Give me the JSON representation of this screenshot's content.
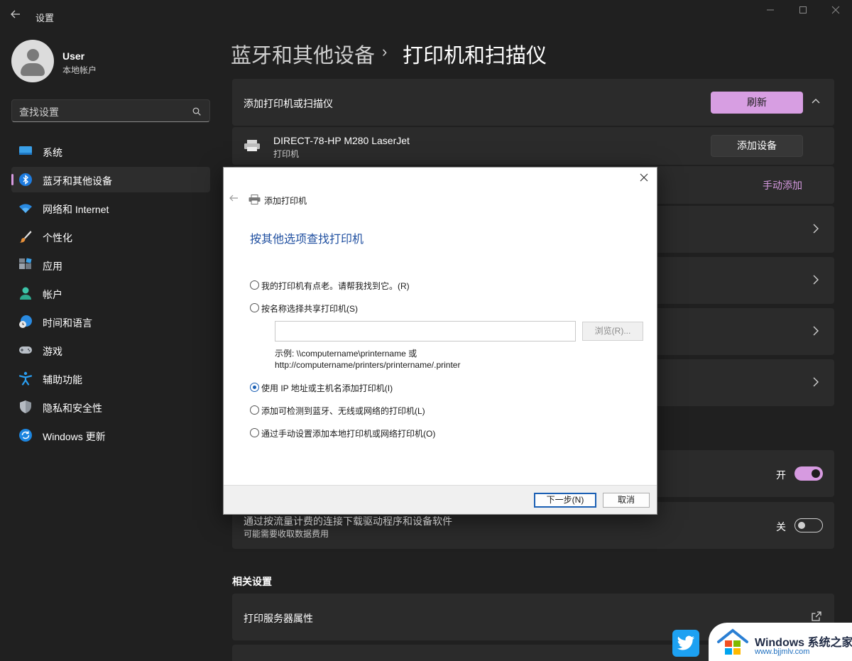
{
  "titlebar": {
    "app_title": "设置",
    "back_icon": "arrow-left-icon",
    "minimize_icon": "minimize-icon",
    "maximize_icon": "maximize-icon",
    "close_icon": "close-icon"
  },
  "profile": {
    "name": "User",
    "account_type": "本地帐户"
  },
  "search": {
    "placeholder": "查找设置"
  },
  "sidebar": {
    "accent_color": "#d69ae0",
    "items": [
      {
        "label": "系统",
        "icon": "monitor-icon"
      },
      {
        "label": "蓝牙和其他设备",
        "icon": "bluetooth-icon",
        "selected": true
      },
      {
        "label": "网络和 Internet",
        "icon": "wifi-icon"
      },
      {
        "label": "个性化",
        "icon": "brush-icon"
      },
      {
        "label": "应用",
        "icon": "apps-icon"
      },
      {
        "label": "帐户",
        "icon": "person-icon"
      },
      {
        "label": "时间和语言",
        "icon": "globe-clock-icon"
      },
      {
        "label": "游戏",
        "icon": "gamepad-icon"
      },
      {
        "label": "辅助功能",
        "icon": "accessibility-icon"
      },
      {
        "label": "隐私和安全性",
        "icon": "shield-icon"
      },
      {
        "label": "Windows 更新",
        "icon": "refresh-icon"
      }
    ]
  },
  "header": {
    "breadcrumb_parent": "蓝牙和其他设备",
    "breadcrumb_separator": "›",
    "breadcrumb_current": "打印机和扫描仪"
  },
  "main": {
    "add_section": {
      "title": "添加打印机或扫描仪",
      "refresh_label": "刷新",
      "found_device_name": "DIRECT-78-HP M280 LaserJet",
      "found_device_type": "打印机",
      "add_device_label": "添加设备",
      "manual_add_label": "手动添加"
    },
    "toggle_on_label": "开",
    "metered": {
      "title": "通过按流量计费的连接下载驱动程序和设备软件",
      "subtitle": "可能需要收取数据费用",
      "state_label": "关"
    },
    "related_settings_heading": "相关设置",
    "print_server_label": "打印服务器属性"
  },
  "dialog": {
    "window_title": "添加打印机",
    "heading": "按其他选项查找打印机",
    "options": [
      {
        "label": "我的打印机有点老。请帮我找到它。(R)",
        "selected": false
      },
      {
        "label": "按名称选择共享打印机(S)",
        "selected": false
      },
      {
        "label": "使用 IP 地址或主机名添加打印机(I)",
        "selected": true
      },
      {
        "label": "添加可检测到蓝牙、无线或网络的打印机(L)",
        "selected": false
      },
      {
        "label": "通过手动设置添加本地打印机或网络打印机(O)",
        "selected": false
      }
    ],
    "share_input_value": "",
    "browse_label": "浏览(R)...",
    "example_line1": "示例: \\\\computername\\printername 或",
    "example_line2": "http://computername/printers/printername/.printer",
    "next_label": "下一步(N)",
    "cancel_label": "取消"
  },
  "watermark": {
    "title": "Windows 系统之家",
    "url": "www.bjjmlv.com"
  }
}
